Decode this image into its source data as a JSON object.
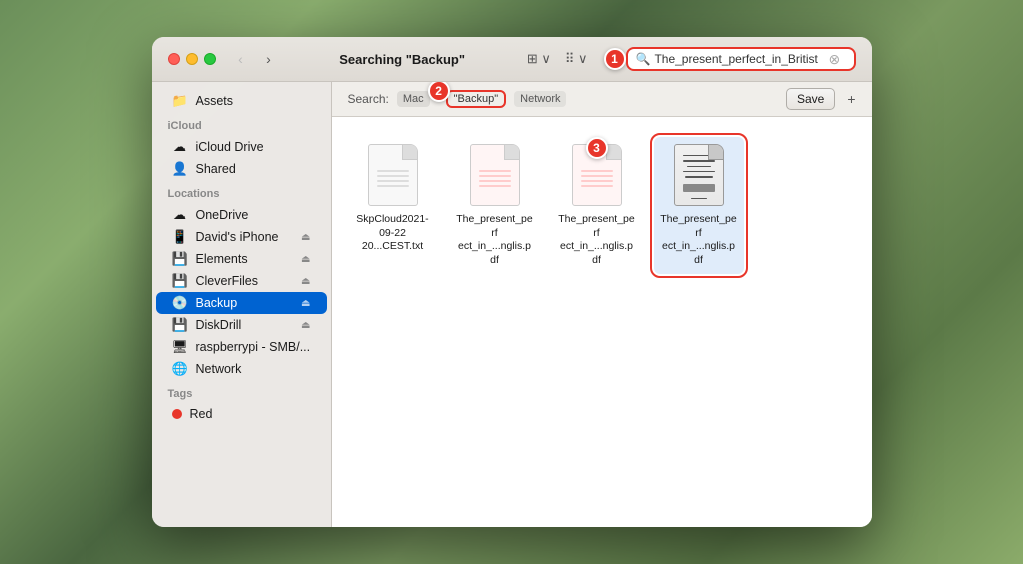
{
  "window": {
    "title": "Searching \"Backup\"",
    "search_placeholder": "The_present_perfect_in_Britist",
    "search_value": "The_present_perfect_in_Britist"
  },
  "titlebar": {
    "back_label": "‹",
    "forward_label": "›",
    "title": "Searching \"Backup\"",
    "view_grid_label": "⊞",
    "view_list_label": "☰",
    "badge1_label": "1"
  },
  "searchbar": {
    "search_label": "Search:",
    "filter_mac_label": "Mac",
    "filter_backup_label": "\"Backup\"",
    "filter_network_label": "Network",
    "save_label": "Save",
    "plus_label": "+",
    "badge2_label": "2"
  },
  "sidebar": {
    "assets_label": "Assets",
    "icloud_section": "iCloud",
    "icloud_drive_label": "iCloud Drive",
    "shared_label": "Shared",
    "locations_section": "Locations",
    "onedrive_label": "OneDrive",
    "davids_iphone_label": "David's iPhone",
    "elements_label": "Elements",
    "cleverfiles_label": "CleverFiles",
    "backup_label": "Backup",
    "diskdrill_label": "DiskDrill",
    "raspberrypi_label": "raspberrypi - SMB/...",
    "network_label": "Network",
    "tags_section": "Tags",
    "red_label": "Red"
  },
  "files": [
    {
      "name": "SkpCloud2021-09-22 20...CEST.txt",
      "type": "txt",
      "badge": null
    },
    {
      "name": "The_present_perf ect_in_...nglis.pdf",
      "type": "pdf",
      "badge": null
    },
    {
      "name": "The_present_perf ect_in_...nglis.pdf",
      "type": "pdf",
      "badge": "3"
    },
    {
      "name": "The_present_perf ect_in_...nglis.pdf",
      "type": "pdf-preview",
      "badge": null,
      "selected": true
    }
  ]
}
